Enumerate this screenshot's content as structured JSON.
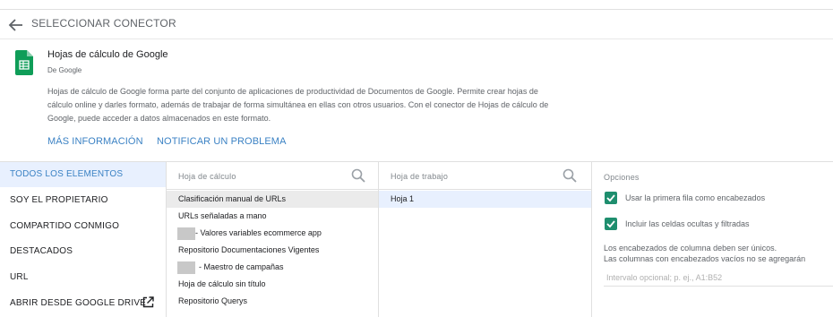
{
  "header": {
    "title": "SELECCIONAR CONECTOR",
    "back_icon": "arrow-left-icon"
  },
  "connector": {
    "name": "Hojas de cálculo de Google",
    "by": "De Google",
    "icon": "google-sheets-icon",
    "description": "Hojas de cálculo de Google forma parte del conjunto de aplicaciones de productividad de Documentos de Google. Permite crear hojas de cálculo online y darles formato, además de trabajar de forma simultánea en ellas con otros usuarios. Con el conector de Hojas de cálculo de Google, puede acceder a datos almacenados en este formato.",
    "links": {
      "more_info": "MÁS INFORMACIÓN",
      "report": "NOTIFICAR UN PROBLEMA"
    }
  },
  "sidebar": {
    "items": [
      {
        "label": "TODOS LOS ELEMENTOS",
        "active": true
      },
      {
        "label": "SOY EL PROPIETARIO"
      },
      {
        "label": "COMPARTIDO CONMIGO"
      },
      {
        "label": "DESTACADOS"
      },
      {
        "label": "URL"
      },
      {
        "label": "ABRIR DESDE GOOGLE DRIVE",
        "icon": "open-external-icon"
      }
    ]
  },
  "spreadsheets": {
    "placeholder": "Hoja de cálculo",
    "items": [
      "Clasificación manual de URLs",
      "URLs señaladas a mano",
      "- Valores variables ecommerce app",
      "Repositorio Documentaciones Vigentes",
      "- Maestro de campañas",
      "Hoja de cálculo sin título",
      "Repositorio Querys"
    ]
  },
  "worksheets": {
    "placeholder": "Hoja de trabajo",
    "items": [
      "Hoja 1"
    ]
  },
  "options": {
    "title": "Opciones",
    "use_first_row": "Usar la primera fila como encabezados",
    "include_hidden": "Incluir las celdas ocultas y filtradas",
    "note_line1": "Los encabezados de columna deben ser únicos.",
    "note_line2": "Las columnas con encabezados vacíos no se agregarán",
    "range_placeholder": "Intervalo opcional; p. ej., A1:B52"
  },
  "colors": {
    "accent": "#3b82c4",
    "checkbox": "#1e8e6e",
    "sheets_green": "#0f9d58"
  }
}
